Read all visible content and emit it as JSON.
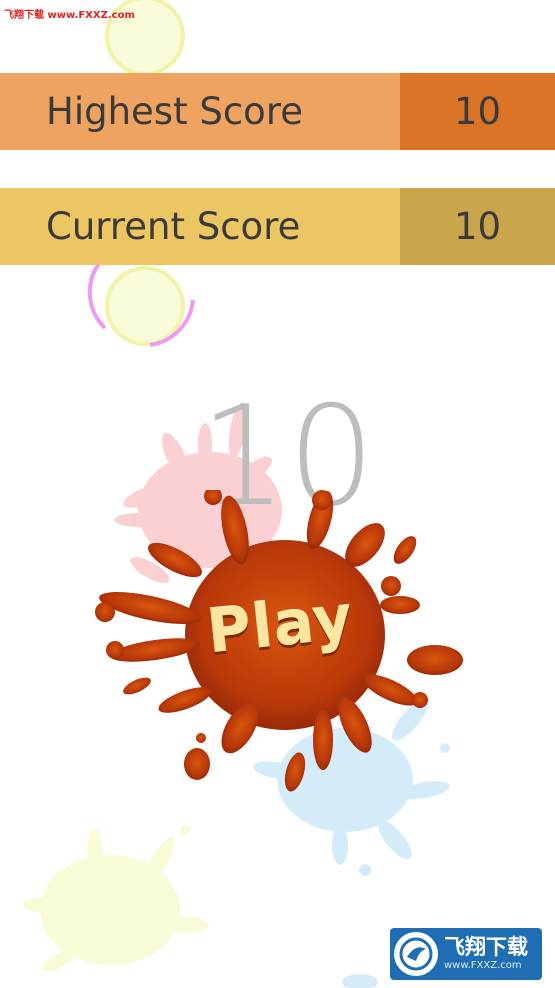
{
  "watermark": {
    "top_text": "飞翔下载 www.FXXZ.com",
    "bottom_name": "飞翔下载",
    "bottom_url": "www.FXXZ.com"
  },
  "scores": {
    "highest_label": "Highest Score",
    "highest_value": "10",
    "current_label": "Current Score",
    "current_value": "10"
  },
  "game": {
    "big_score": "10",
    "play_label": "Play"
  },
  "colors": {
    "highest_label_bg": "#eea360",
    "highest_value_bg": "#dc7428",
    "current_label_bg": "#ebc662",
    "current_value_bg": "#c9a64c",
    "play_splat": "#c8440a",
    "bubble_fill": "#f8fbd8",
    "bubble_ring": "#f0f29a",
    "bubble_arc": "#ee9af2"
  }
}
